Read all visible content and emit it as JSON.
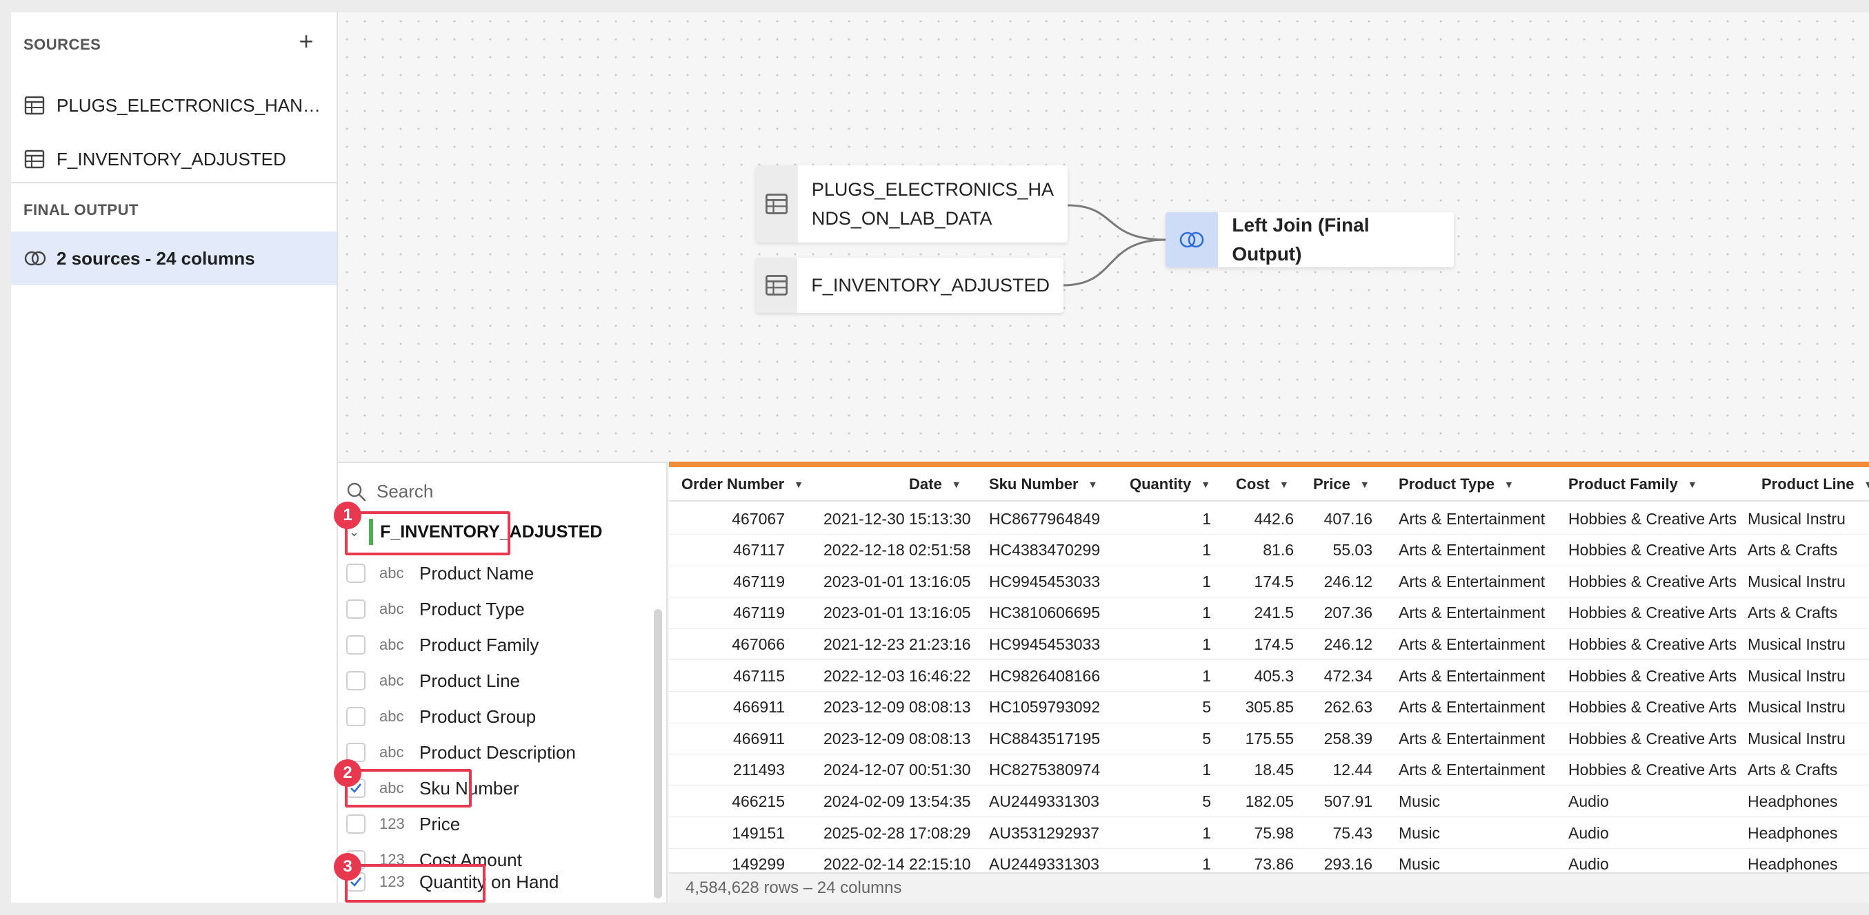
{
  "sidebar": {
    "sources_heading": "SOURCES",
    "add_icon": "plus-icon",
    "sources": [
      {
        "label": "PLUGS_ELECTRONICS_HANDS_ON_LAB_DATA",
        "icon": "table-icon"
      },
      {
        "label": "F_INVENTORY_ADJUSTED",
        "icon": "table-icon"
      }
    ],
    "final_output_heading": "FINAL OUTPUT",
    "final_output": {
      "label": "2 sources - 24 columns",
      "icon": "join-icon"
    }
  },
  "canvas": {
    "node_source_1": "PLUGS_ELECTRONICS_HANDS_ON_LAB_DATA",
    "node_source_1_line1": "PLUGS_ELECTRONICS_HA",
    "node_source_1_line2": "NDS_ON_LAB_DATA",
    "node_source_2": "F_INVENTORY_ADJUSTED",
    "node_join": "Left Join (Final Output)"
  },
  "column_panel": {
    "search_placeholder": "Search",
    "group_name": "F_INVENTORY_ADJUSTED",
    "fields": [
      {
        "type": "abc",
        "name": "Product Name",
        "checked": false
      },
      {
        "type": "abc",
        "name": "Product Type",
        "checked": false
      },
      {
        "type": "abc",
        "name": "Product Family",
        "checked": false
      },
      {
        "type": "abc",
        "name": "Product Line",
        "checked": false
      },
      {
        "type": "abc",
        "name": "Product Group",
        "checked": false
      },
      {
        "type": "abc",
        "name": "Product Description",
        "checked": false
      },
      {
        "type": "abc",
        "name": "Sku Number",
        "checked": true
      },
      {
        "type": "123",
        "name": "Price",
        "checked": false
      },
      {
        "type": "123",
        "name": "Cost Amount",
        "checked": false
      },
      {
        "type": "123",
        "name": "Quantity on Hand",
        "checked": true
      }
    ],
    "callouts": [
      "1",
      "2",
      "3"
    ]
  },
  "table": {
    "columns": [
      "Order Number",
      "Date",
      "Sku Number",
      "Quantity",
      "Cost",
      "Price",
      "Product Type",
      "Product Family",
      "Product Line"
    ],
    "rows": [
      [
        "467067",
        "2021-12-30 15:13:30",
        "HC8677964849",
        "1",
        "442.6",
        "407.16",
        "Arts & Entertainment",
        "Hobbies & Creative Arts",
        "Musical Instru"
      ],
      [
        "467117",
        "2022-12-18 02:51:58",
        "HC4383470299",
        "1",
        "81.6",
        "55.03",
        "Arts & Entertainment",
        "Hobbies & Creative Arts",
        "Arts & Crafts"
      ],
      [
        "467119",
        "2023-01-01 13:16:05",
        "HC9945453033",
        "1",
        "174.5",
        "246.12",
        "Arts & Entertainment",
        "Hobbies & Creative Arts",
        "Musical Instru"
      ],
      [
        "467119",
        "2023-01-01 13:16:05",
        "HC3810606695",
        "1",
        "241.5",
        "207.36",
        "Arts & Entertainment",
        "Hobbies & Creative Arts",
        "Arts & Crafts"
      ],
      [
        "467066",
        "2021-12-23 21:23:16",
        "HC9945453033",
        "1",
        "174.5",
        "246.12",
        "Arts & Entertainment",
        "Hobbies & Creative Arts",
        "Musical Instru"
      ],
      [
        "467115",
        "2022-12-03 16:46:22",
        "HC9826408166",
        "1",
        "405.3",
        "472.34",
        "Arts & Entertainment",
        "Hobbies & Creative Arts",
        "Musical Instru"
      ],
      [
        "466911",
        "2023-12-09 08:08:13",
        "HC1059793092",
        "5",
        "305.85",
        "262.63",
        "Arts & Entertainment",
        "Hobbies & Creative Arts",
        "Musical Instru"
      ],
      [
        "466911",
        "2023-12-09 08:08:13",
        "HC8843517195",
        "5",
        "175.55",
        "258.39",
        "Arts & Entertainment",
        "Hobbies & Creative Arts",
        "Musical Instru"
      ],
      [
        "211493",
        "2024-12-07 00:51:30",
        "HC8275380974",
        "1",
        "18.45",
        "12.44",
        "Arts & Entertainment",
        "Hobbies & Creative Arts",
        "Arts & Crafts"
      ],
      [
        "466215",
        "2024-02-09 13:54:35",
        "AU2449331303",
        "5",
        "182.05",
        "507.91",
        "Music",
        "Audio",
        "Headphones"
      ],
      [
        "149151",
        "2025-02-28 17:08:29",
        "AU3531292937",
        "1",
        "75.98",
        "75.43",
        "Music",
        "Audio",
        "Headphones"
      ],
      [
        "149299",
        "2022-02-14 22:15:10",
        "AU2449331303",
        "1",
        "73.86",
        "293.16",
        "Music",
        "Audio",
        "Headphones"
      ]
    ],
    "footer": "4,584,628 rows – 24 columns"
  }
}
